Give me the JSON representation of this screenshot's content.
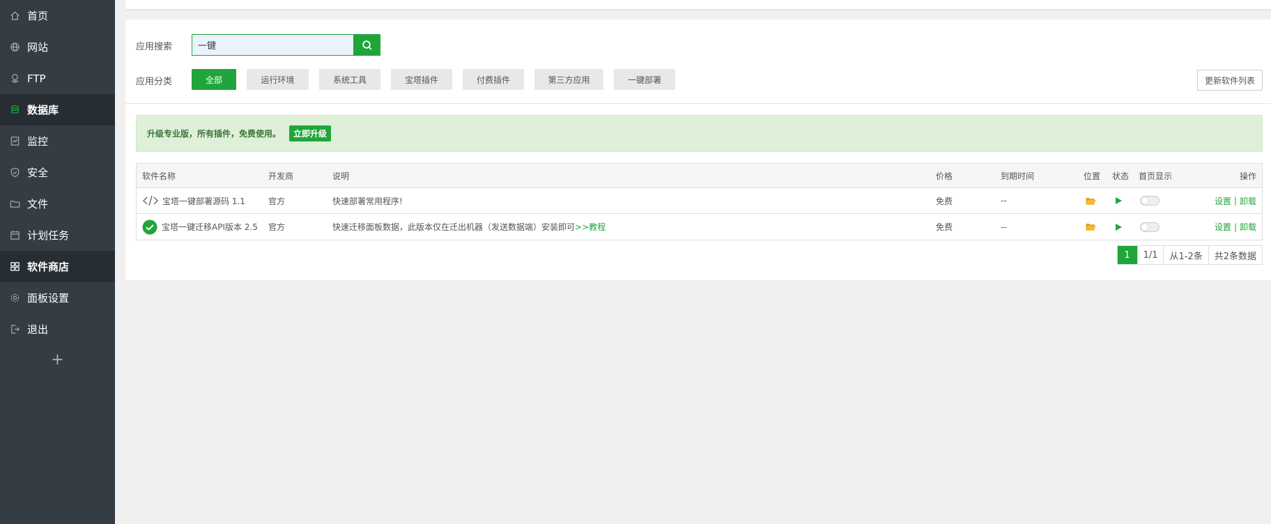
{
  "sidebar": {
    "items": [
      {
        "label": "首页",
        "icon": "home-icon",
        "active": false
      },
      {
        "label": "网站",
        "icon": "globe-icon",
        "active": false
      },
      {
        "label": "FTP",
        "icon": "ftp-icon",
        "active": false
      },
      {
        "label": "数据库",
        "icon": "database-icon",
        "active": true
      },
      {
        "label": "监控",
        "icon": "monitor-icon",
        "active": false
      },
      {
        "label": "安全",
        "icon": "shield-icon",
        "active": false
      },
      {
        "label": "文件",
        "icon": "folder-icon",
        "active": false
      },
      {
        "label": "计划任务",
        "icon": "calendar-icon",
        "active": false
      },
      {
        "label": "软件商店",
        "icon": "apps-icon",
        "active": true
      },
      {
        "label": "面板设置",
        "icon": "gear-icon",
        "active": false
      },
      {
        "label": "退出",
        "icon": "logout-icon",
        "active": false
      }
    ],
    "add_label": "+"
  },
  "search": {
    "label": "应用搜索",
    "value": "一键"
  },
  "categories": {
    "label": "应用分类",
    "items": [
      "全部",
      "运行环境",
      "系统工具",
      "宝塔插件",
      "付费插件",
      "第三方应用",
      "一键部署"
    ],
    "active_index": 0
  },
  "refresh_label": "更新软件列表",
  "promo": {
    "text": "升级专业版，所有插件，免费使用。",
    "button": "立即升级"
  },
  "table": {
    "headers": {
      "name": "软件名称",
      "developer": "开发商",
      "description": "说明",
      "price": "价格",
      "expire": "到期时间",
      "location": "位置",
      "status": "状态",
      "homepage": "首页显示",
      "actions": "操作"
    },
    "rows": [
      {
        "icon": "code-icon",
        "name": "宝塔一键部署源码 1.1",
        "developer": "官方",
        "description": "快速部署常用程序!",
        "description_link": "",
        "price": "免费",
        "expire": "--",
        "setting": "设置",
        "separator": "|",
        "uninstall": "卸载"
      },
      {
        "icon": "check-circle-icon",
        "name": "宝塔一键迁移API版本 2.5",
        "developer": "官方",
        "description": "快速迁移面板数据，此版本仅在迁出机器（发送数据端）安装即可",
        "description_link": ">>教程",
        "price": "免费",
        "expire": "--",
        "setting": "设置",
        "separator": "|",
        "uninstall": "卸载"
      }
    ]
  },
  "pagination": {
    "current": "1",
    "pages": "1/1",
    "range": "从1-2条",
    "total": "共2条数据"
  },
  "colors": {
    "accent": "#20a53a",
    "sidebar_bg": "#353d44",
    "sidebar_active_bg": "#272e33",
    "promo_bg": "#dff0d8",
    "folder": "#f6b93b"
  }
}
